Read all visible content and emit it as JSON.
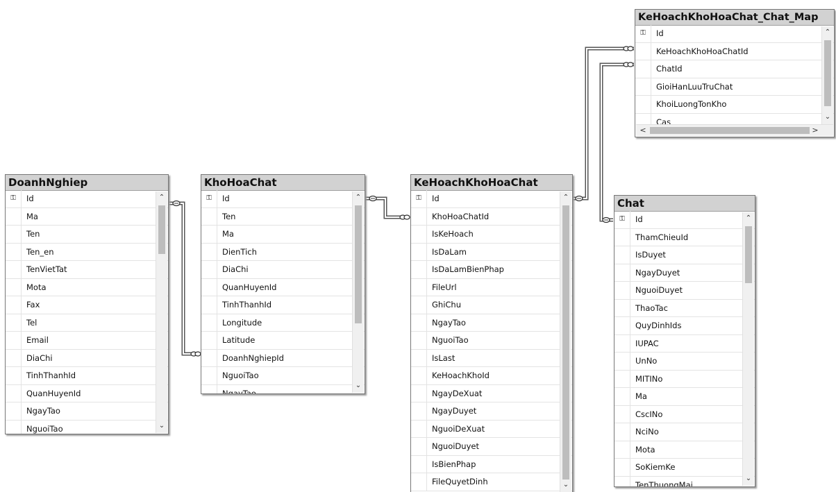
{
  "tables": {
    "doanhnghiep": {
      "title": "DoanhNghiep",
      "columns": [
        "Id",
        "Ma",
        "Ten",
        "Ten_en",
        "TenVietTat",
        "Mota",
        "Fax",
        "Tel",
        "Email",
        "DiaChi",
        "TinhThanhId",
        "QuanHuyenId",
        "NgayTao",
        "NguoiTao"
      ]
    },
    "khohoachat": {
      "title": "KhoHoaChat",
      "columns": [
        "Id",
        "Ten",
        "Ma",
        "DienTich",
        "DiaChi",
        "QuanHuyenId",
        "TinhThanhId",
        "Longitude",
        "Latitude",
        "DoanhNghiepId",
        "NguoiTao",
        "NgayTao"
      ]
    },
    "kehoachkhohoachat": {
      "title": "KeHoachKhoHoaChat",
      "columns": [
        "Id",
        "KhoHoaChatId",
        "IsKeHoach",
        "IsDaLam",
        "IsDaLamBienPhap",
        "FileUrl",
        "GhiChu",
        "NgayTao",
        "NguoiTao",
        "IsLast",
        "KeHoachKhoId",
        "NgayDeXuat",
        "NgayDuyet",
        "NguoiDeXuat",
        "NguoiDuyet",
        "IsBienPhap",
        "FileQuyetDinh"
      ]
    },
    "kehoach_chat_map": {
      "title": "KeHoachKhoHoaChat_Chat_Map",
      "columns": [
        "Id",
        "KeHoachKhoHoaChatId",
        "ChatId",
        "GioiHanLuuTruChat",
        "KhoiLuongTonKho",
        "Cas"
      ]
    },
    "chat": {
      "title": "Chat",
      "columns": [
        "Id",
        "ThamChieuId",
        "IsDuyet",
        "NgayDuyet",
        "NguoiDuyet",
        "ThaoTac",
        "QuyDinhIds",
        "IUPAC",
        "UnNo",
        "MITINo",
        "Ma",
        "CscINo",
        "NciNo",
        "Mota",
        "SoKiemKe",
        "TenThuongMai"
      ]
    }
  },
  "icons": {
    "primary_key": "key-icon",
    "scroll_up": "chevron-up-icon",
    "scroll_down": "chevron-down-icon",
    "scroll_left": "chevron-left-icon",
    "scroll_right": "chevron-right-icon"
  },
  "glyphs": {
    "key": "⚿",
    "up": "⌃",
    "down": "⌄",
    "left": "<",
    "right": ">"
  },
  "colors": {
    "title_bar": "#d2d2d2",
    "connector": "#555555",
    "scroll_thumb": "#bdbdbd"
  }
}
